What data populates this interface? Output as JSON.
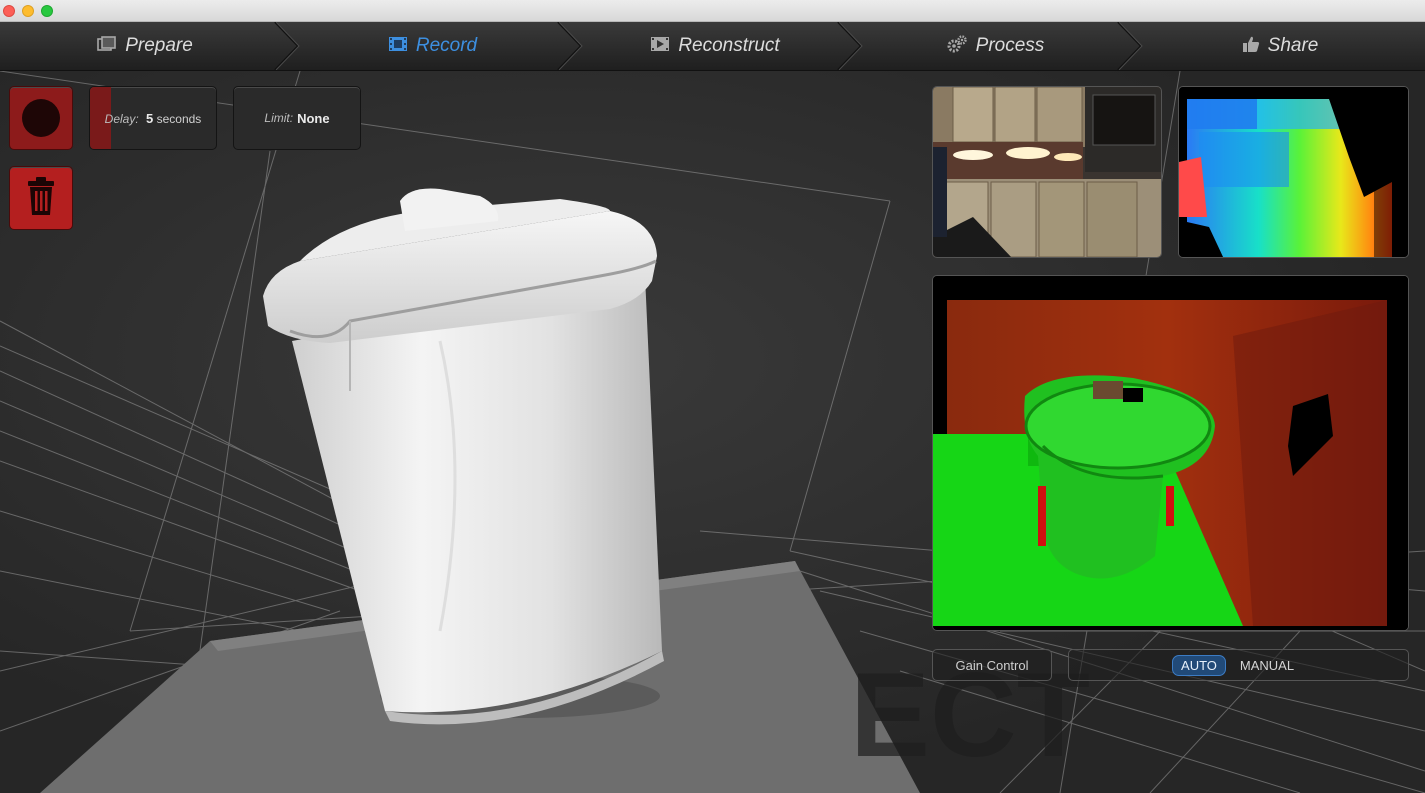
{
  "window": {
    "close_label": "",
    "minimize_label": "",
    "maximize_label": ""
  },
  "nav": {
    "tabs": [
      {
        "label": "Prepare",
        "icon": "photos-icon",
        "active": false
      },
      {
        "label": "Record",
        "icon": "film-icon",
        "active": true
      },
      {
        "label": "Reconstruct",
        "icon": "clapper-icon",
        "active": false
      },
      {
        "label": "Process",
        "icon": "gears-icon",
        "active": false
      },
      {
        "label": "Share",
        "icon": "thumbs-up-icon",
        "active": false
      }
    ]
  },
  "controls": {
    "record_icon": "record-icon",
    "trash_icon": "trash-icon",
    "delay": {
      "label": "Delay:",
      "value": "5",
      "unit": "seconds",
      "progress_fraction": 0.17
    },
    "limit": {
      "label": "Limit:",
      "value": "None"
    }
  },
  "gain": {
    "label": "Gain Control",
    "options": [
      "AUTO",
      "MANUAL"
    ],
    "selected": "AUTO"
  },
  "watermark": "ECT",
  "colors": {
    "accent": "#3d8fe0",
    "record_red": "#8d1b1b",
    "trash_red": "#b41f1f",
    "depth_green": "#16d616",
    "depth_red": "#8a1a0a"
  }
}
